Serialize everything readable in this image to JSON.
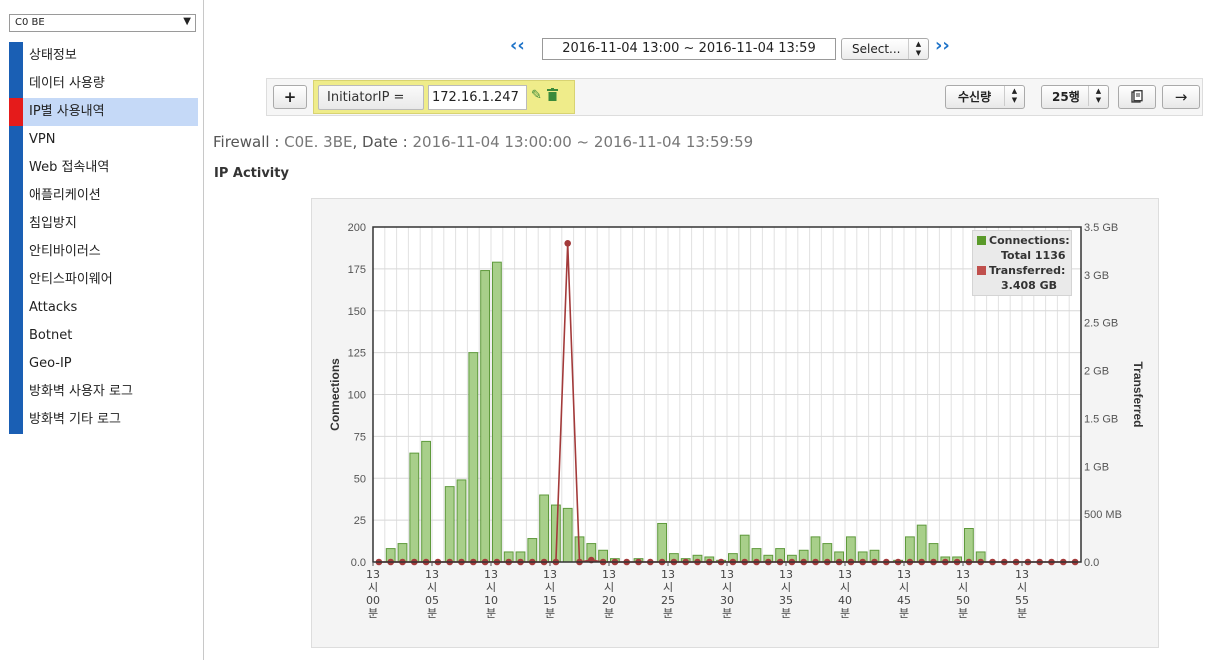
{
  "sidebar": {
    "firewall_selected": "C0           BE",
    "menu": [
      {
        "label": "상태정보",
        "active": false
      },
      {
        "label": "데이터 사용량",
        "active": false
      },
      {
        "label": "IP별 사용내역",
        "active": true
      },
      {
        "label": "VPN",
        "active": false
      },
      {
        "label": "Web 접속내역",
        "active": false
      },
      {
        "label": "애플리케이션",
        "active": false
      },
      {
        "label": "침입방지",
        "active": false
      },
      {
        "label": "안티바이러스",
        "active": false
      },
      {
        "label": "안티스파이웨어",
        "active": false
      },
      {
        "label": "Attacks",
        "active": false
      },
      {
        "label": "Botnet",
        "active": false
      },
      {
        "label": "Geo-IP",
        "active": false
      },
      {
        "label": "방화벽 사용자 로그",
        "active": false
      },
      {
        "label": "방화벽 기타 로그",
        "active": false
      }
    ]
  },
  "datebar": {
    "prev": "‹‹",
    "next": "››",
    "range": "2016-11-04 13:00 ~ 2016-11-04 13:59",
    "select_label": "Select..."
  },
  "filterbar": {
    "add_label": "+",
    "field": "InitiatorIP =",
    "value": "172.16.1.247",
    "sort_label": "수신량",
    "rows_label": "25행",
    "copy_icon": "copy-icon",
    "export_icon": "arrow-right-icon"
  },
  "info": {
    "firewall_label": "Firewall : ",
    "firewall_value": "C0E.            3BE",
    "date_label": ", Date : ",
    "date_value": "2016-11-04 13:00:00 ~ 2016-11-04 13:59:59"
  },
  "section_title": "IP Activity",
  "colors": {
    "accent": "#1a5fb4",
    "active_marker": "#e51b1b",
    "bar": "#a8cf8a",
    "line": "#a33a3a",
    "legend_bar": "#5a9a2a"
  },
  "chart_data": {
    "type": "bar",
    "ylabel": "Connections",
    "y2label": "Transferred",
    "ylim": [
      0,
      200
    ],
    "y2lim": [
      0,
      3.5
    ],
    "yticks": [
      "0.0",
      "25",
      "50",
      "75",
      "100",
      "125",
      "150",
      "175",
      "200"
    ],
    "y2ticks": [
      "0.0",
      "500 MB",
      "1 GB",
      "1.5 GB",
      "2 GB",
      "2.5 GB",
      "3 GB",
      "3.5 GB"
    ],
    "xticks": [
      {
        "minute": 0,
        "label": [
          "13",
          "시",
          "00",
          "분"
        ]
      },
      {
        "minute": 5,
        "label": [
          "13",
          "시",
          "05",
          "분"
        ]
      },
      {
        "minute": 10,
        "label": [
          "13",
          "시",
          "10",
          "분"
        ]
      },
      {
        "minute": 15,
        "label": [
          "13",
          "시",
          "15",
          "분"
        ]
      },
      {
        "minute": 20,
        "label": [
          "13",
          "시",
          "20",
          "분"
        ]
      },
      {
        "minute": 25,
        "label": [
          "13",
          "시",
          "25",
          "분"
        ]
      },
      {
        "minute": 30,
        "label": [
          "13",
          "시",
          "30",
          "분"
        ]
      },
      {
        "minute": 35,
        "label": [
          "13",
          "시",
          "35",
          "분"
        ]
      },
      {
        "minute": 40,
        "label": [
          "13",
          "시",
          "40",
          "분"
        ]
      },
      {
        "minute": 45,
        "label": [
          "13",
          "시",
          "45",
          "분"
        ]
      },
      {
        "minute": 50,
        "label": [
          "13",
          "시",
          "50",
          "분"
        ]
      },
      {
        "minute": 55,
        "label": [
          "13",
          "시",
          "55",
          "분"
        ]
      }
    ],
    "series": [
      {
        "name": "Connections:",
        "total_label": "Total 1136",
        "values": [
          0,
          8,
          11,
          65,
          72,
          0,
          45,
          49,
          125,
          174,
          179,
          6,
          6,
          14,
          40,
          34,
          32,
          15,
          11,
          7,
          2,
          0,
          2,
          0,
          23,
          5,
          2,
          4,
          3,
          1,
          5,
          16,
          8,
          4,
          8,
          4,
          7,
          15,
          11,
          6,
          15,
          6,
          7,
          0,
          1,
          15,
          22,
          11,
          3,
          3,
          20,
          6,
          0,
          0,
          0,
          0,
          0,
          0,
          0,
          0
        ]
      },
      {
        "name": "Transferred:",
        "total_label": "3.408 GB",
        "unit": "GB",
        "values": [
          0,
          0,
          0,
          0,
          0,
          0,
          0,
          0,
          0,
          0,
          0,
          0,
          0,
          0,
          0,
          0,
          3.33,
          0,
          0.02,
          0,
          0,
          0,
          0,
          0,
          0,
          0,
          0,
          0,
          0,
          0,
          0,
          0,
          0,
          0,
          0,
          0,
          0,
          0,
          0,
          0,
          0,
          0,
          0,
          0,
          0,
          0,
          0,
          0,
          0,
          0,
          0,
          0,
          0,
          0,
          0,
          0,
          0,
          0,
          0,
          0
        ]
      }
    ]
  }
}
